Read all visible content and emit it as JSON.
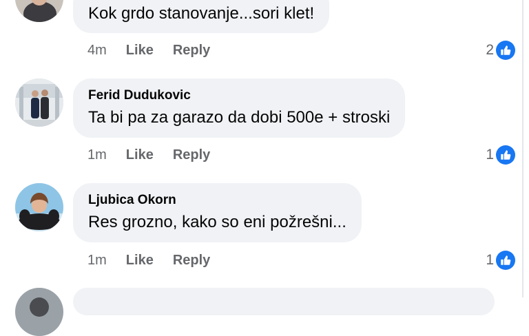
{
  "colors": {
    "background": "#ffffff",
    "bubble": "#f0f2f5",
    "meta_text": "#65676b",
    "reaction_blue": "#1877f2"
  },
  "comments": [
    {
      "author": "",
      "text": "Kok grdo stanovanje...sori klet!",
      "time": "4m",
      "like_label": "Like",
      "reply_label": "Reply",
      "reaction_count": "2",
      "reaction_icon": "thumbs-up-icon"
    },
    {
      "author": "Ferid Dudukovic",
      "text": "Ta bi pa za garazo da dobi 500e + stroski",
      "time": "1m",
      "like_label": "Like",
      "reply_label": "Reply",
      "reaction_count": "1",
      "reaction_icon": "thumbs-up-icon"
    },
    {
      "author": "Ljubica Okorn",
      "text": "Res grozno, kako so eni požrešni...",
      "time": "1m",
      "like_label": "Like",
      "reply_label": "Reply",
      "reaction_count": "1",
      "reaction_icon": "thumbs-up-icon"
    }
  ]
}
